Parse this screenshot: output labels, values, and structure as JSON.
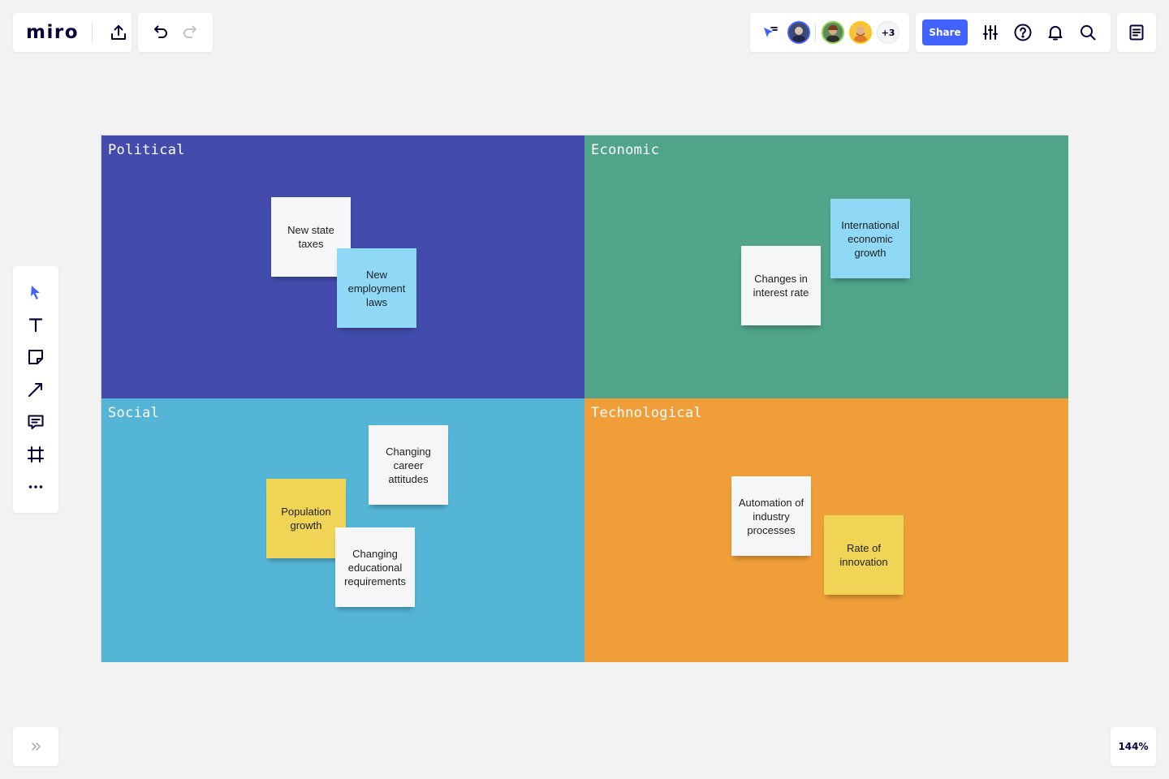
{
  "app": {
    "logo": "miro",
    "zoom": "144%"
  },
  "collaborators": {
    "more_count": "+3"
  },
  "actions": {
    "share_label": "Share"
  },
  "board": {
    "quadrants": [
      {
        "title": "Political",
        "color": "#434cad"
      },
      {
        "title": "Economic",
        "color": "#4fa48a"
      },
      {
        "title": "Social",
        "color": "#55b5d6"
      },
      {
        "title": "Technological",
        "color": "#f09e39"
      }
    ],
    "political_notes": [
      {
        "text": "New state taxes",
        "color": "white"
      },
      {
        "text": "New employment laws",
        "color": "blue"
      }
    ],
    "economic_notes": [
      {
        "text": "International economic growth",
        "color": "blue"
      },
      {
        "text": "Changes in interest rate",
        "color": "white"
      }
    ],
    "social_notes": [
      {
        "text": "Changing career attitudes",
        "color": "white"
      },
      {
        "text": "Population growth",
        "color": "yellow"
      },
      {
        "text": "Changing educational requirements",
        "color": "white"
      }
    ],
    "tech_notes": [
      {
        "text": "Automation of industry processes",
        "color": "white"
      },
      {
        "text": "Rate of innovation",
        "color": "yellow"
      }
    ]
  },
  "colors": {
    "accent": "#4262ff",
    "ink": "#050038"
  }
}
